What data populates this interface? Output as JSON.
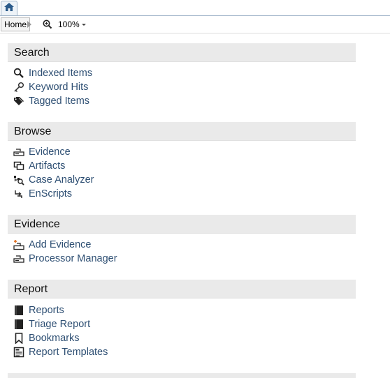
{
  "tabs": {
    "home_icon": "home-icon"
  },
  "toolbar": {
    "crumb": "Home",
    "zoom": "100%"
  },
  "colors": {
    "link": "#2e4f73",
    "section_bg": "#eaeaea",
    "accent_orange": "#e07020"
  },
  "sections": [
    {
      "title": "Search",
      "items": [
        {
          "label": "Indexed Items",
          "icon": "magnifier-icon"
        },
        {
          "label": "Keyword Hits",
          "icon": "key-icon"
        },
        {
          "label": "Tagged Items",
          "icon": "tags-icon"
        }
      ]
    },
    {
      "title": "Browse",
      "items": [
        {
          "label": "Evidence",
          "icon": "evidence-drive-icon"
        },
        {
          "label": "Artifacts",
          "icon": "artifacts-icon"
        },
        {
          "label": "Case Analyzer",
          "icon": "case-analyzer-icon"
        },
        {
          "label": "EnScripts",
          "icon": "enscripts-icon"
        }
      ]
    },
    {
      "title": "Evidence",
      "items": [
        {
          "label": "Add Evidence",
          "icon": "add-evidence-icon"
        },
        {
          "label": "Processor Manager",
          "icon": "processor-icon"
        }
      ]
    },
    {
      "title": "Report",
      "items": [
        {
          "label": "Reports",
          "icon": "book-icon"
        },
        {
          "label": "Triage Report",
          "icon": "book-icon"
        },
        {
          "label": "Bookmarks",
          "icon": "bookmark-icon"
        },
        {
          "label": "Report Templates",
          "icon": "template-icon"
        }
      ]
    }
  ]
}
